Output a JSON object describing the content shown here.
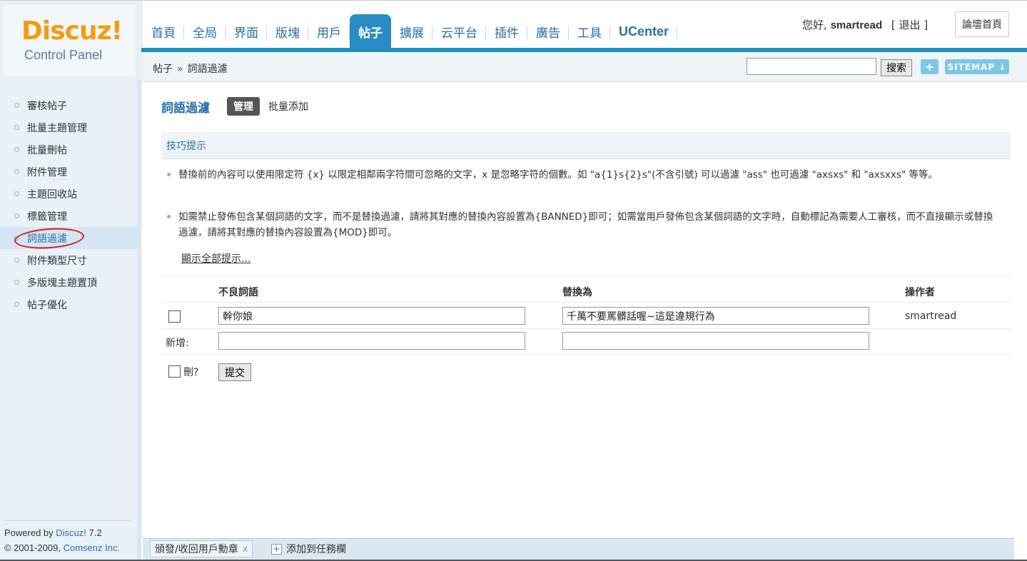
{
  "logo": {
    "brand": "Discuz!",
    "subtitle": "Control Panel"
  },
  "nav": {
    "items": [
      {
        "label": "首頁"
      },
      {
        "label": "全局"
      },
      {
        "label": "界面"
      },
      {
        "label": "版塊"
      },
      {
        "label": "用戶"
      },
      {
        "label": "帖子"
      },
      {
        "label": "擴展"
      },
      {
        "label": "云平台"
      },
      {
        "label": "插件"
      },
      {
        "label": "廣告"
      },
      {
        "label": "工具"
      },
      {
        "label": "UCenter"
      }
    ],
    "active": "帖子"
  },
  "user": {
    "greeting": "您好,",
    "username": "smartread",
    "logout": "[ 退出 ]",
    "forum_home": "論壇首頁"
  },
  "crumb": {
    "section": "帖子",
    "separator": "»",
    "page": "詞語過濾"
  },
  "search": {
    "button": "搜索",
    "value": ""
  },
  "toolbar": {
    "plus_label": "+",
    "sitemap_label": "SITEMAP ↓"
  },
  "sidebar": {
    "items": [
      {
        "label": "審核帖子"
      },
      {
        "label": "批量主題管理"
      },
      {
        "label": "批量刪帖"
      },
      {
        "label": "附件管理"
      },
      {
        "label": "主題回收站"
      },
      {
        "label": "標籤管理"
      },
      {
        "label": "詞語過濾"
      },
      {
        "label": "附件類型尺寸"
      },
      {
        "label": "多版塊主題置頂"
      },
      {
        "label": "帖子優化"
      }
    ],
    "active": "詞語過濾"
  },
  "powered": {
    "prefix": "Powered by ",
    "product": "Discuz!",
    "version": " 7.2",
    "copyright": "© 2001-2009, ",
    "company": "Comsenz Inc."
  },
  "main": {
    "title": "詞語過濾",
    "tab_manage": "管理",
    "tab_batch": "批量添加",
    "tips_title": "技巧提示",
    "tip1": "替換前的內容可以使用限定符 {x} 以限定相鄰兩字符間可忽略的文字，x 是忽略字符的個數。如 \"a{1}s{2}s\"(不含引號) 可以過濾 \"ass\" 也可過濾 \"axsxs\" 和 \"axsxxs\" 等等。",
    "tip2": "如需禁止發佈包含某個詞語的文字，而不是替換過濾，請將其對應的替換內容設置為{BANNED}即可；如需當用戶發佈包含某個詞語的文字時，自動標記為需要人工審核，而不直接顯示或替換過濾，請將其對應的替換內容設置為{MOD}即可。",
    "show_all": "顯示全部提示..."
  },
  "table": {
    "headers": {
      "bad_word": "不良詞語",
      "replace": "替換為",
      "operator": "操作者"
    },
    "rows": [
      {
        "checked": false,
        "find": "幹你娘",
        "replacement": "千萬不要罵髒話喔~這是違規行為",
        "operator": "smartread"
      }
    ],
    "new_label": "新增:",
    "new_find": "",
    "new_replacement": "",
    "delete_label": "刪?",
    "submit": "提交"
  },
  "taskbar": {
    "task1": "頒發/收回用戶勳章",
    "task1_close": "x",
    "add_label": "添加到任務欄"
  },
  "colors": {
    "accent": "#2a8cc4",
    "link": "#2a6fa8",
    "brand": "#f39c12",
    "annotation": "#e01818"
  }
}
